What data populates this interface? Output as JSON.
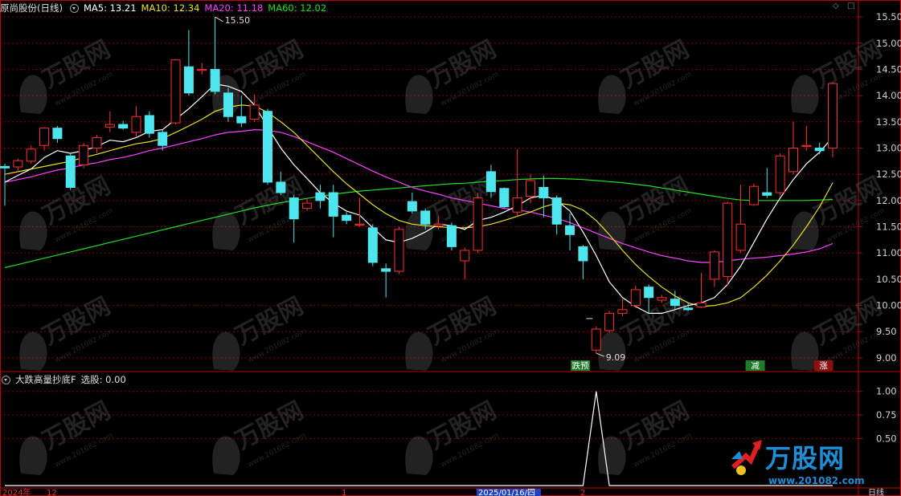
{
  "header": {
    "stock": "原尚股份(日线)",
    "ma5": {
      "label": "MA5: 13.21",
      "color": "#ffffff"
    },
    "ma10": {
      "label": "MA10: 12.34",
      "color": "#e8e020"
    },
    "ma20": {
      "label": "MA20: 11.18",
      "color": "#ff40ff"
    },
    "ma60": {
      "label": "MA60: 12.02",
      "color": "#20e020"
    }
  },
  "indicator_header": {
    "name": "大跌高量抄底F",
    "value": "选股: 0.00"
  },
  "markers": {
    "high": "15.50",
    "low": "9.09",
    "tag1": "跌预",
    "tag2": "减",
    "tag3": "涨"
  },
  "bottom_axis": {
    "year": "2024年",
    "dec": "12",
    "jan": "1",
    "cursor_date": "2025/01/16/四",
    "feb": "2",
    "period": "日线"
  },
  "watermark": {
    "text": "万股网",
    "small": "www.201082.com"
  },
  "brand": {
    "name": "万股网",
    "url": "www.201082.com"
  },
  "colors": {
    "up": "#ff3030",
    "down": "#4de6ee",
    "grid": "#8a0000",
    "axis": "#c00000"
  },
  "chart_data": [
    {
      "type": "candlestick",
      "title": "原尚股份(日线)",
      "ylim": [
        8.8,
        15.7
      ],
      "yticks": [
        "9.00",
        "9.50",
        "10.00",
        "10.50",
        "11.00",
        "11.50",
        "12.00",
        "12.50",
        "13.00",
        "13.50",
        "14.00",
        "14.50",
        "15.00",
        "15.50"
      ],
      "candles": [
        [
          12.65,
          12.62,
          12.7,
          11.9
        ],
        [
          12.64,
          12.76,
          12.8,
          12.55
        ],
        [
          12.75,
          12.98,
          13.05,
          12.7
        ],
        [
          13.05,
          13.38,
          13.4,
          12.95
        ],
        [
          13.38,
          13.18,
          13.42,
          13.1
        ],
        [
          12.85,
          12.25,
          12.9,
          12.2
        ],
        [
          12.68,
          13.05,
          13.1,
          12.62
        ],
        [
          13.0,
          13.2,
          13.25,
          12.9
        ],
        [
          13.4,
          13.45,
          13.7,
          13.3
        ],
        [
          13.45,
          13.38,
          13.52,
          13.35
        ],
        [
          13.3,
          13.6,
          13.8,
          13.22
        ],
        [
          13.62,
          13.28,
          13.7,
          13.2
        ],
        [
          13.3,
          13.05,
          13.35,
          12.95
        ],
        [
          13.48,
          14.68,
          14.7,
          13.45
        ],
        [
          14.55,
          14.05,
          15.25,
          14.0
        ],
        [
          14.48,
          14.5,
          14.62,
          14.4
        ],
        [
          14.5,
          14.08,
          15.5,
          14.02
        ],
        [
          14.05,
          13.6,
          14.15,
          13.5
        ],
        [
          13.6,
          13.48,
          14.0,
          13.4
        ],
        [
          13.55,
          13.82,
          14.02,
          13.5
        ],
        [
          13.7,
          12.35,
          13.75,
          12.3
        ],
        [
          12.35,
          12.15,
          12.55,
          12.1
        ],
        [
          12.05,
          11.65,
          12.1,
          11.2
        ],
        [
          11.85,
          11.95,
          12.05,
          11.8
        ],
        [
          12.15,
          12.0,
          12.3,
          11.85
        ],
        [
          12.15,
          11.7,
          12.3,
          11.3
        ],
        [
          11.72,
          11.62,
          11.78,
          11.55
        ],
        [
          11.55,
          11.55,
          12.05,
          11.5
        ],
        [
          11.48,
          10.82,
          11.55,
          10.75
        ],
        [
          10.7,
          10.65,
          10.8,
          10.15
        ],
        [
          10.65,
          11.45,
          11.5,
          10.6
        ],
        [
          11.98,
          11.8,
          12.15,
          11.75
        ],
        [
          11.8,
          11.55,
          11.85,
          11.45
        ],
        [
          11.52,
          11.55,
          11.7,
          11.45
        ],
        [
          11.52,
          11.12,
          11.58,
          11.05
        ],
        [
          10.85,
          11.05,
          11.1,
          10.5
        ],
        [
          11.05,
          12.05,
          12.15,
          11.0
        ],
        [
          12.55,
          12.17,
          12.68,
          12.05
        ],
        [
          12.23,
          11.88,
          12.25,
          11.85
        ],
        [
          11.78,
          12.05,
          12.98,
          11.7
        ],
        [
          12.08,
          12.38,
          12.5,
          11.95
        ],
        [
          12.25,
          12.05,
          12.48,
          11.68
        ],
        [
          12.05,
          11.55,
          12.1,
          11.35
        ],
        [
          11.52,
          11.35,
          11.75,
          11.05
        ],
        [
          11.12,
          10.85,
          11.15,
          10.5
        ],
        [
          9.15,
          9.55,
          9.6,
          9.09
        ],
        [
          9.52,
          9.85,
          9.9,
          9.48
        ],
        [
          9.85,
          9.92,
          10.12,
          9.8
        ],
        [
          10.0,
          10.3,
          10.38,
          9.95
        ],
        [
          10.35,
          10.15,
          10.4,
          9.85
        ],
        [
          10.1,
          10.15,
          10.2,
          10.05
        ],
        [
          10.12,
          10.0,
          10.28,
          9.92
        ],
        [
          9.95,
          9.92,
          10.05,
          9.9
        ],
        [
          9.97,
          10.05,
          10.62,
          9.95
        ],
        [
          10.5,
          11.02,
          11.05,
          10.35
        ],
        [
          10.55,
          11.95,
          11.98,
          10.38
        ],
        [
          11.05,
          11.55,
          12.3,
          11.0
        ],
        [
          11.92,
          12.27,
          12.32,
          11.9
        ],
        [
          12.15,
          12.1,
          12.62,
          12.05
        ],
        [
          12.15,
          12.85,
          12.9,
          12.1
        ],
        [
          12.55,
          13.0,
          13.5,
          12.5
        ],
        [
          13.05,
          13.05,
          13.42,
          12.95
        ],
        [
          13.0,
          12.95,
          13.1,
          12.88
        ],
        [
          13.0,
          14.23,
          14.25,
          12.82
        ]
      ],
      "ma5": [
        12.35,
        12.48,
        12.6,
        12.82,
        12.95,
        12.9,
        12.95,
        13.03,
        13.15,
        13.12,
        13.2,
        13.32,
        13.35,
        13.55,
        13.75,
        13.98,
        14.22,
        14.18,
        14.08,
        13.82,
        13.4,
        13.0,
        12.68,
        12.42,
        12.15,
        11.95,
        11.8,
        11.72,
        11.48,
        11.25,
        11.2,
        11.28,
        11.4,
        11.55,
        11.52,
        11.45,
        11.62,
        11.68,
        11.78,
        11.9,
        12.05,
        12.1,
        12.0,
        11.8,
        11.4,
        10.95,
        10.45,
        10.15,
        9.98,
        9.85,
        9.85,
        9.92,
        10.0,
        10.05,
        10.15,
        10.4,
        10.75,
        11.2,
        11.65,
        12.05,
        12.4,
        12.7,
        12.92,
        13.21
      ],
      "ma10": [
        12.5,
        12.55,
        12.6,
        12.65,
        12.7,
        12.75,
        12.82,
        12.88,
        12.95,
        13.02,
        13.08,
        13.12,
        13.18,
        13.3,
        13.42,
        13.55,
        13.7,
        13.78,
        13.82,
        13.8,
        13.68,
        13.5,
        13.3,
        13.05,
        12.8,
        12.55,
        12.32,
        12.12,
        11.92,
        11.75,
        11.62,
        11.55,
        11.52,
        11.5,
        11.48,
        11.48,
        11.5,
        11.55,
        11.62,
        11.7,
        11.78,
        11.88,
        11.95,
        11.92,
        11.82,
        11.62,
        11.35,
        11.05,
        10.78,
        10.55,
        10.35,
        10.18,
        10.05,
        9.98,
        10.0,
        10.05,
        10.15,
        10.35,
        10.58,
        10.85,
        11.15,
        11.5,
        11.88,
        12.34
      ],
      "ma20": [
        12.35,
        12.4,
        12.45,
        12.52,
        12.58,
        12.62,
        12.68,
        12.72,
        12.78,
        12.82,
        12.88,
        12.95,
        13.0,
        13.06,
        13.12,
        13.18,
        13.25,
        13.3,
        13.32,
        13.35,
        13.34,
        13.3,
        13.22,
        13.12,
        13.02,
        12.92,
        12.8,
        12.68,
        12.56,
        12.45,
        12.35,
        12.25,
        12.18,
        12.12,
        12.05,
        12.0,
        11.95,
        11.9,
        11.85,
        11.82,
        11.78,
        11.72,
        11.66,
        11.58,
        11.48,
        11.38,
        11.28,
        11.18,
        11.1,
        11.02,
        10.95,
        10.9,
        10.85,
        10.82,
        10.82,
        10.85,
        10.88,
        10.9,
        10.92,
        10.95,
        10.98,
        11.02,
        11.08,
        11.18
      ],
      "ma60": [
        10.72,
        10.78,
        10.84,
        10.9,
        10.96,
        11.02,
        11.08,
        11.14,
        11.2,
        11.26,
        11.32,
        11.38,
        11.44,
        11.5,
        11.56,
        11.62,
        11.68,
        11.74,
        11.8,
        11.86,
        11.91,
        11.96,
        12.0,
        12.04,
        12.08,
        12.12,
        12.15,
        12.18,
        12.2,
        12.22,
        12.24,
        12.26,
        12.28,
        12.3,
        12.32,
        12.33,
        12.35,
        12.37,
        12.38,
        12.4,
        12.41,
        12.42,
        12.42,
        12.41,
        12.4,
        12.38,
        12.36,
        12.34,
        12.31,
        12.28,
        12.24,
        12.2,
        12.16,
        12.12,
        12.08,
        12.04,
        12.01,
        12.0,
        12.0,
        12.0,
        12.0,
        12.0,
        12.01,
        12.02
      ]
    },
    {
      "type": "line",
      "title": "大跌高量抄底F",
      "ylim": [
        0,
        1.1
      ],
      "yticks": [
        "0.50",
        "0.75",
        "1.00"
      ],
      "values": [
        0,
        0,
        0,
        0,
        0,
        0,
        0,
        0,
        0,
        0,
        0,
        0,
        0,
        0,
        0,
        0,
        0,
        0,
        0,
        0,
        0,
        0,
        0,
        0,
        0,
        0,
        0,
        0,
        0,
        0,
        0,
        0,
        0,
        0,
        0,
        0,
        0,
        0,
        0,
        0,
        0,
        0,
        0,
        0,
        0,
        1,
        0,
        0,
        0,
        0,
        0,
        0,
        0,
        0,
        0,
        0,
        0,
        0,
        0,
        0,
        0,
        0,
        0,
        0
      ]
    }
  ]
}
